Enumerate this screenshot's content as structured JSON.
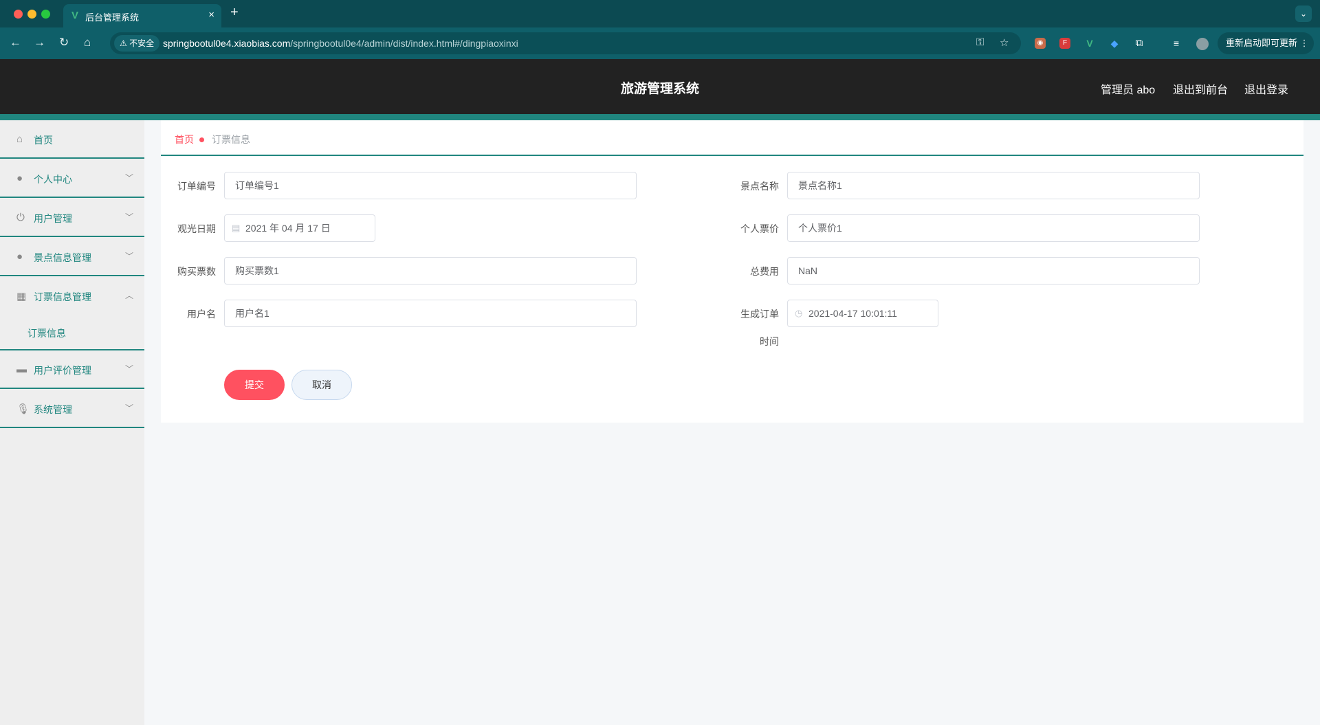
{
  "browser": {
    "tab_title": "后台管理系统",
    "tab_close": "×",
    "new_tab": "+",
    "insecure_label": "不安全",
    "url_host": "springbootul0e4.xiaobias.com",
    "url_path": "/springbootul0e4/admin/dist/index.html#/dingpiaoxinxi",
    "update_button": "重新启动即可更新"
  },
  "header": {
    "title": "旅游管理系统",
    "admin_label": "管理员 abo",
    "back_to_front": "退出到前台",
    "logout": "退出登录"
  },
  "sidebar": {
    "items": [
      {
        "label": "首页",
        "icon": "home-icon"
      },
      {
        "label": "个人中心",
        "icon": "user-icon"
      },
      {
        "label": "用户管理",
        "icon": "power-icon"
      },
      {
        "label": "景点信息管理",
        "icon": "user-icon"
      },
      {
        "label": "订票信息管理",
        "icon": "grid-icon"
      },
      {
        "label": "用户评价管理",
        "icon": "printer-icon"
      },
      {
        "label": "系统管理",
        "icon": "microphone-icon"
      }
    ],
    "subitem": "订票信息"
  },
  "breadcrumb": {
    "home": "首页",
    "current": "订票信息"
  },
  "form": {
    "order_no": {
      "label": "订单编号",
      "value": "订单编号1"
    },
    "spot_name": {
      "label": "景点名称",
      "value": "景点名称1"
    },
    "visit_date": {
      "label": "观光日期",
      "value": "2021 年 04 月 17 日"
    },
    "unit_price": {
      "label": "个人票价",
      "value": "个人票价1"
    },
    "ticket_count": {
      "label": "购买票数",
      "value": "购买票数1"
    },
    "total": {
      "label": "总费用",
      "value": "NaN"
    },
    "username": {
      "label": "用户名",
      "value": "用户名1"
    },
    "created_time": {
      "label_line1": "生成订单",
      "label_line2": "时间",
      "value": "2021-04-17 10:01:11"
    },
    "submit": "提交",
    "cancel": "取消"
  },
  "colors": {
    "accent": "#20867f",
    "primary_button": "#ff5160",
    "header_bg": "#222222"
  }
}
